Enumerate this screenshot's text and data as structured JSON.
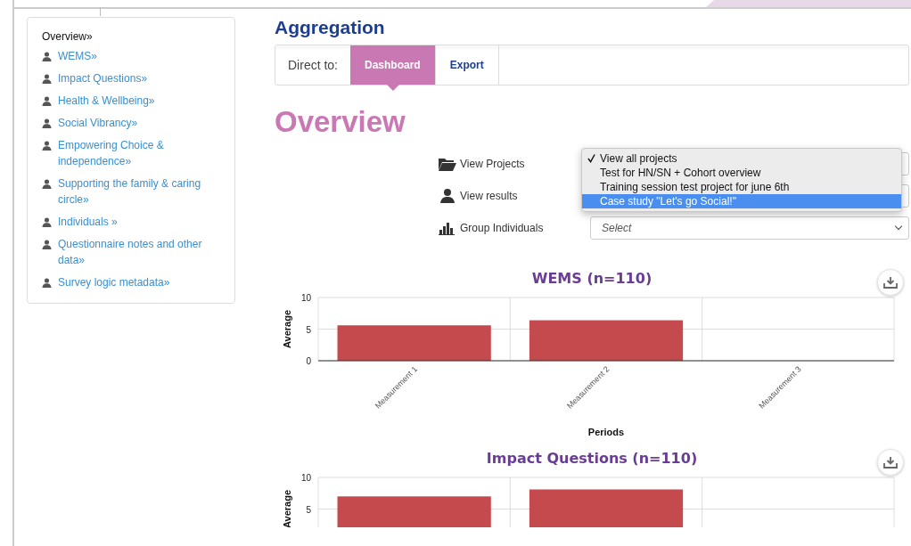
{
  "sidebar": {
    "title": "Overview»",
    "items": [
      {
        "label": "WEMS»"
      },
      {
        "label": "Impact Questions»"
      },
      {
        "label": "Health & Wellbeing»"
      },
      {
        "label": "Social Vibrancy»"
      },
      {
        "label": "Empowering Choice & independence»"
      },
      {
        "label": "Supporting the family & caring circle»"
      },
      {
        "label": "Individuals »"
      },
      {
        "label": "Questionnaire notes and other data»"
      },
      {
        "label": "Survey logic metadata»"
      }
    ]
  },
  "header": {
    "title": "Aggregation",
    "direct_label": "Direct to:",
    "tabs": [
      {
        "label": "Dashboard",
        "selected": true
      },
      {
        "label": "Export",
        "selected": false
      }
    ]
  },
  "page_title": "Overview",
  "filters": [
    {
      "kind": "folder",
      "label": "View Projects"
    },
    {
      "kind": "person",
      "label": "View results"
    },
    {
      "kind": "bars",
      "label": "Group Individuals",
      "placeholder": "Select"
    }
  ],
  "dropdown": {
    "options": [
      {
        "label": "View all projects",
        "checked": true,
        "selected": false
      },
      {
        "label": "Test for HN/SN + Cohort overview",
        "checked": false,
        "selected": false
      },
      {
        "label": "Training session test project for june 6th",
        "checked": false,
        "selected": false
      },
      {
        "label": "Case study \"Let's go Social!\"",
        "checked": false,
        "selected": true
      }
    ]
  },
  "charts": [
    {
      "chart_data": {
        "type": "bar",
        "title": "WEMS (n=110)",
        "xlabel": "Periods",
        "ylabel": "Average",
        "categories": [
          "Measurement 1",
          "Measurement 2",
          "Measurement 3"
        ],
        "series": [
          {
            "color": "#c44a4d",
            "values": [
              5.6,
              6.4,
              null
            ]
          }
        ],
        "ylim": [
          0,
          10
        ],
        "yticks": [
          0,
          5,
          10
        ]
      }
    },
    {
      "chart_data": {
        "type": "bar",
        "title": "Impact Questions (n=110)",
        "ylabel": "Average",
        "series": [
          {
            "color": "#c44a4d",
            "values": [
              7,
              8.1,
              null
            ]
          }
        ],
        "ylim": [
          0,
          10
        ],
        "yticks": [
          5,
          10
        ]
      }
    }
  ]
}
